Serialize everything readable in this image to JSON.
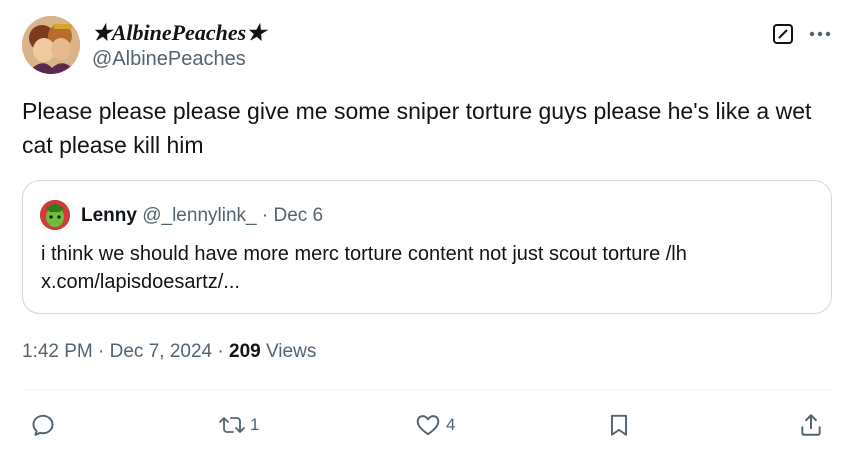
{
  "author": {
    "display_name": "★AlbinePeaches★",
    "handle": "@AlbinePeaches"
  },
  "tweet": {
    "text": "Please please please give me some sniper torture guys please he's like a wet cat please kill him"
  },
  "quote": {
    "author_name": "Lenny",
    "author_meta": "@_lennylink_ · Dec 6",
    "text_line1": "i think we should have more merc torture content not just scout torture /lh",
    "text_line2": "x.com/lapisdoesartz/..."
  },
  "meta": {
    "time_date": "1:42 PM · Dec 7, 2024 · ",
    "views_count": "209",
    "views_label": " Views"
  },
  "actions": {
    "reposts": "1",
    "likes": "4"
  },
  "icons": {
    "reply": "reply-icon",
    "repost": "repost-icon",
    "like": "heart-icon",
    "bookmark": "bookmark-icon",
    "share": "share-icon",
    "grok": "grok-icon",
    "more": "more-icon"
  },
  "colors": {
    "text_primary": "#0f1419",
    "text_secondary": "#536471",
    "border": "#cfd9de"
  }
}
